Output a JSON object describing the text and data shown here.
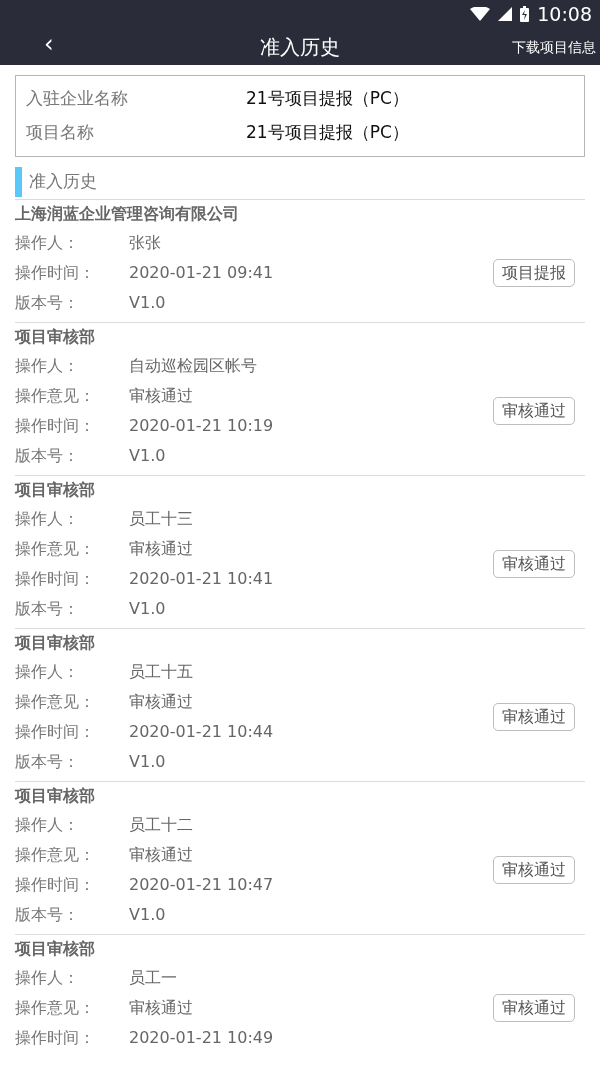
{
  "status_bar": {
    "time": "10:08"
  },
  "nav": {
    "back": "‹",
    "title": "准入历史",
    "action": "下载项目信息"
  },
  "info": [
    {
      "label": "入驻企业名称",
      "value": "21号项目提报（PC）"
    },
    {
      "label": "项目名称",
      "value": "21号项目提报（PC）"
    }
  ],
  "section_title": "准入历史",
  "records": [
    {
      "department": "上海润蓝企业管理咨询有限公司",
      "fields": [
        {
          "label": "操作人：",
          "value": "张张"
        },
        {
          "label": "操作时间：",
          "value": "2020-01-21 09:41"
        },
        {
          "label": "版本号：",
          "value": "V1.0"
        }
      ],
      "action": "项目提报"
    },
    {
      "department": "项目审核部",
      "fields": [
        {
          "label": "操作人：",
          "value": "自动巡检园区帐号"
        },
        {
          "label": "操作意见：",
          "value": "审核通过"
        },
        {
          "label": "操作时间：",
          "value": "2020-01-21 10:19"
        },
        {
          "label": "版本号：",
          "value": "V1.0"
        }
      ],
      "action": "审核通过"
    },
    {
      "department": "项目审核部",
      "fields": [
        {
          "label": "操作人：",
          "value": "员工十三"
        },
        {
          "label": "操作意见：",
          "value": "审核通过"
        },
        {
          "label": "操作时间：",
          "value": "2020-01-21 10:41"
        },
        {
          "label": "版本号：",
          "value": "V1.0"
        }
      ],
      "action": "审核通过"
    },
    {
      "department": "项目审核部",
      "fields": [
        {
          "label": "操作人：",
          "value": "员工十五"
        },
        {
          "label": "操作意见：",
          "value": "审核通过"
        },
        {
          "label": "操作时间：",
          "value": "2020-01-21 10:44"
        },
        {
          "label": "版本号：",
          "value": "V1.0"
        }
      ],
      "action": "审核通过"
    },
    {
      "department": "项目审核部",
      "fields": [
        {
          "label": "操作人：",
          "value": "员工十二"
        },
        {
          "label": "操作意见：",
          "value": "审核通过"
        },
        {
          "label": "操作时间：",
          "value": "2020-01-21 10:47"
        },
        {
          "label": "版本号：",
          "value": "V1.0"
        }
      ],
      "action": "审核通过"
    },
    {
      "department": "项目审核部",
      "fields": [
        {
          "label": "操作人：",
          "value": "员工一"
        },
        {
          "label": "操作意见：",
          "value": "审核通过"
        },
        {
          "label": "操作时间：",
          "value": "2020-01-21 10:49"
        }
      ],
      "action": "审核通过"
    }
  ]
}
